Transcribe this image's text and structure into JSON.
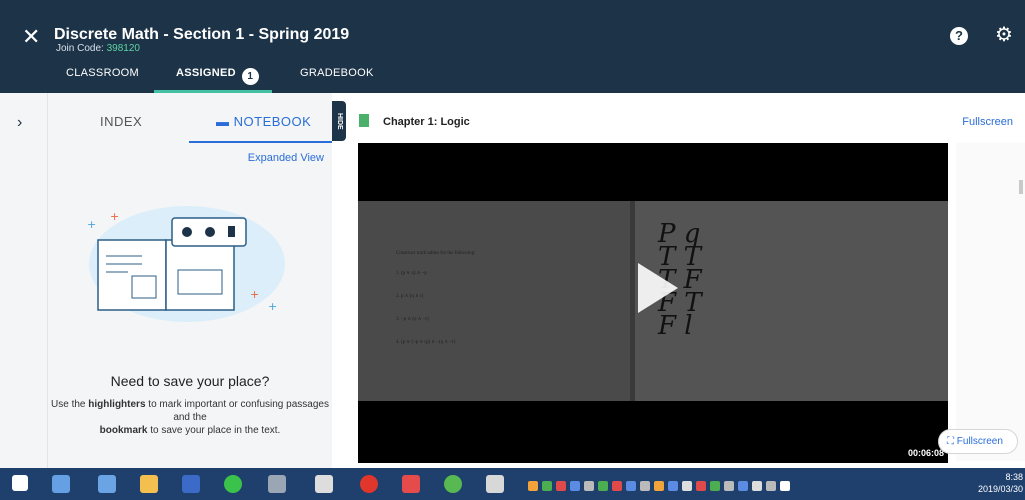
{
  "header": {
    "close_glyph": "✕",
    "course_title": "Discrete Math - Section 1 - Spring 2019",
    "join_label": "Join Code: ",
    "join_code": "398120",
    "tabs": {
      "classroom": "CLASSROOM",
      "assigned": "ASSIGNED",
      "assigned_count": "1",
      "gradebook": "GRADEBOOK"
    },
    "help_glyph": "?",
    "gear_glyph": "⚙"
  },
  "notebook_panel": {
    "index_tab": "INDEX",
    "notebook_tab": "NOTEBOOK",
    "expanded_view": "Expanded View",
    "hide_label": "HIDE",
    "empty_title": "Need to save your place?",
    "empty_use": "Use the ",
    "empty_highlighters": "highlighters",
    "empty_mid": " to mark important or confusing passages and the ",
    "empty_bookmark": "bookmark",
    "empty_end": " to save your place in the text."
  },
  "content": {
    "chapter_title": "Chapter 1: Logic",
    "fullscreen_link": "Fullscreen",
    "fullscreen_pill": "Fullscreen",
    "video_time": "00:06:08",
    "board_heading": "Construct truth tables for the following:",
    "board_items": [
      "1. (p ∨ q) ∧ ~p",
      "2. p ∧ (q ∧ r)",
      "3. ~p ∧ (q ∧ ~r)",
      "4. (p ∨ (~p ∨ q)) ∧ ~(q ∧ ~r)"
    ],
    "handwriting": [
      "P q",
      "T T",
      "T F",
      "F T",
      "F l"
    ]
  },
  "taskbar": {
    "time": "8:38",
    "date": "2019/03/30",
    "icons": [
      "windows-start",
      "visual-studio",
      "explorer",
      "folder",
      "vscode",
      "line",
      "app",
      "paint",
      "chrome",
      "app2",
      "wechat",
      "app3"
    ],
    "colors": {
      "bar": "#1f3f6d",
      "header": "#1d3347",
      "accent": "#44c1a4",
      "link": "#2a6dd8"
    }
  }
}
